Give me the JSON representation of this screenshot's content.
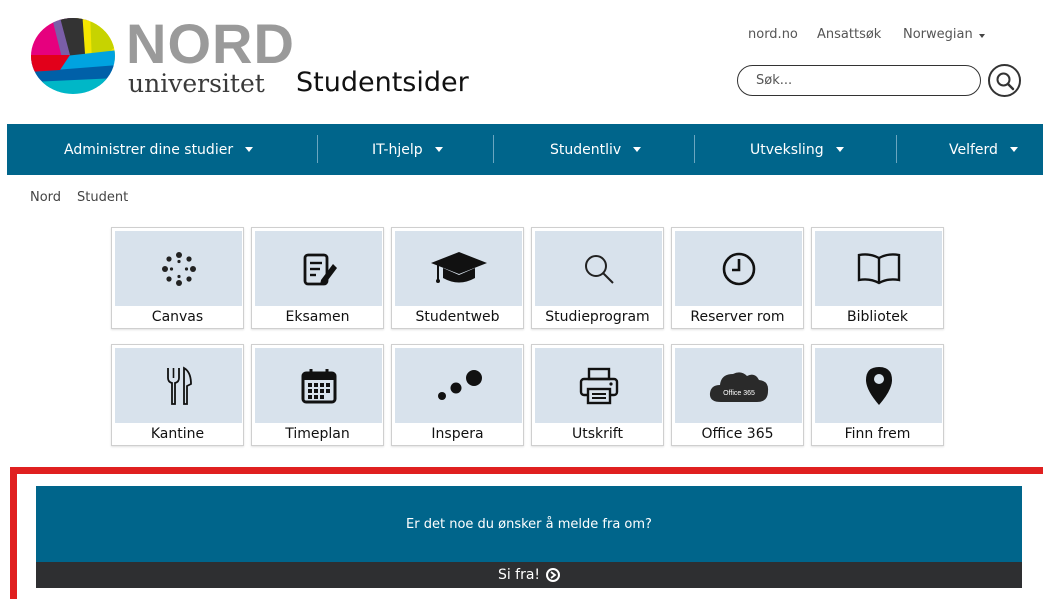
{
  "header": {
    "logo_top": "NORD",
    "logo_bottom": "universitet",
    "site_title": "Studentsider",
    "top_links": [
      "nord.no",
      "Ansattsøk",
      "Norwegian"
    ],
    "search_placeholder": "Søk..."
  },
  "nav": {
    "items": [
      {
        "label": "Administrer dine studier"
      },
      {
        "label": "IT-hjelp"
      },
      {
        "label": "Studentliv"
      },
      {
        "label": "Utveksling"
      },
      {
        "label": "Velferd"
      }
    ]
  },
  "breadcrumb": [
    "Nord",
    "Student"
  ],
  "tiles": [
    {
      "label": "Canvas",
      "icon": "canvas-icon"
    },
    {
      "label": "Eksamen",
      "icon": "exam-icon"
    },
    {
      "label": "Studentweb",
      "icon": "graduation-cap-icon"
    },
    {
      "label": "Studieprogram",
      "icon": "search-icon"
    },
    {
      "label": "Reserver rom",
      "icon": "clock-icon"
    },
    {
      "label": "Bibliotek",
      "icon": "book-icon"
    },
    {
      "label": "Kantine",
      "icon": "fork-knife-icon"
    },
    {
      "label": "Timeplan",
      "icon": "calendar-icon"
    },
    {
      "label": "Inspera",
      "icon": "dots-icon"
    },
    {
      "label": "Utskrift",
      "icon": "printer-icon"
    },
    {
      "label": "Office 365",
      "icon": "office365-cloud-icon",
      "icon_text": "Office 365"
    },
    {
      "label": "Finn frem",
      "icon": "map-pin-icon"
    }
  ],
  "report": {
    "question": "Er det noe du ønsker å melde fra om?",
    "button": "Si fra!"
  },
  "colors": {
    "primary": "#00658b",
    "accent_red": "#e02020",
    "dark": "#2e2f31",
    "tile_bg": "#d8e2ec"
  }
}
